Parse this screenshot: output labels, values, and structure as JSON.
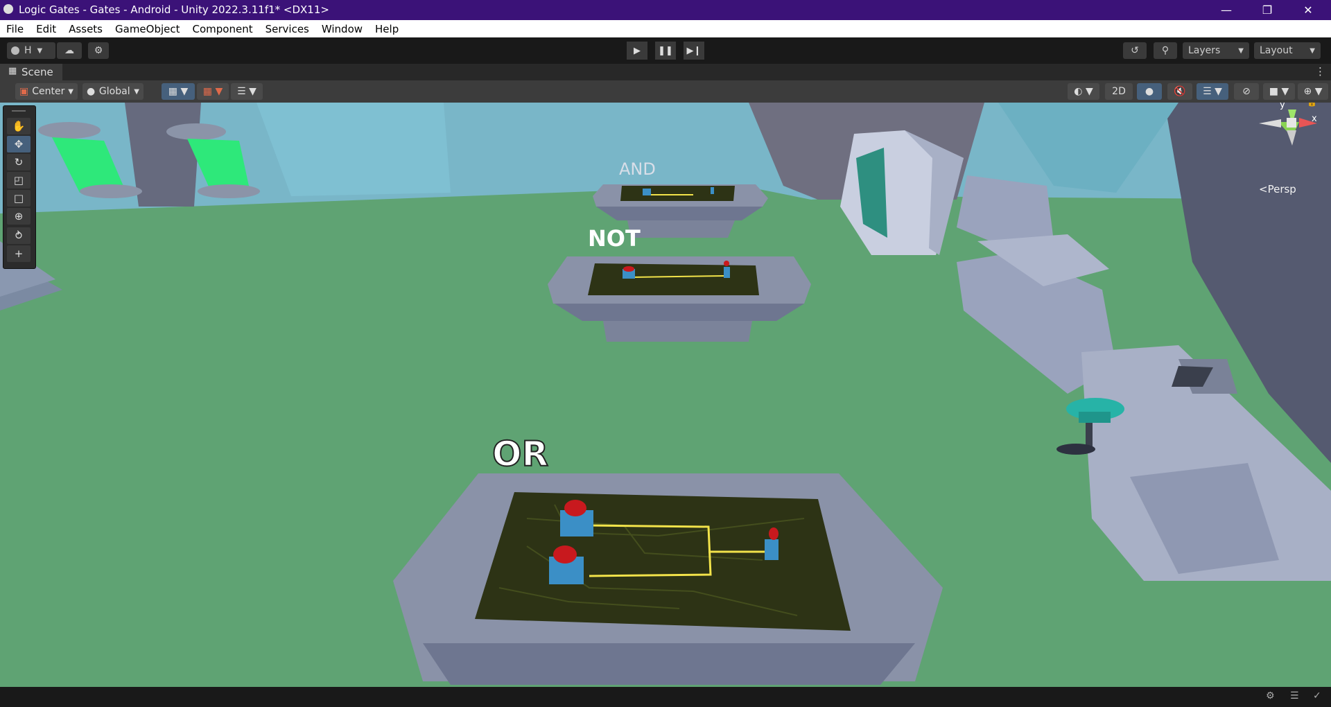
{
  "window": {
    "title": "Logic Gates - Gates - Android - Unity 2022.3.11f1* <DX11>",
    "minimize_icon": "minimize-icon",
    "maximize_icon": "restore-icon",
    "close_icon": "close-icon"
  },
  "menu": [
    "File",
    "Edit",
    "Assets",
    "GameObject",
    "Component",
    "Services",
    "Window",
    "Help"
  ],
  "toolbar": {
    "account_label": "H",
    "layers_label": "Layers",
    "layout_label": "Layout"
  },
  "scene_tab": {
    "label": "Scene"
  },
  "scene_toolbar": {
    "pivot_label": "Center",
    "space_label": "Global",
    "mode_2d_label": "2D"
  },
  "gizmo": {
    "y_label": "y",
    "x_label": "x",
    "projection_label": "Persp"
  },
  "scene_labels": {
    "and_label": "AND",
    "not_label": "NOT",
    "or_label": "OR"
  },
  "colors": {
    "titlebar": "#3b1278",
    "floor": "#5fa373",
    "wall": "#79b6c8",
    "table": "#8a92a8",
    "board": "#2d3315",
    "wire": "#f2e34a",
    "button_red": "#c8191e",
    "button_blue": "#3b8fc6",
    "tube_green": "#2ee87a"
  }
}
